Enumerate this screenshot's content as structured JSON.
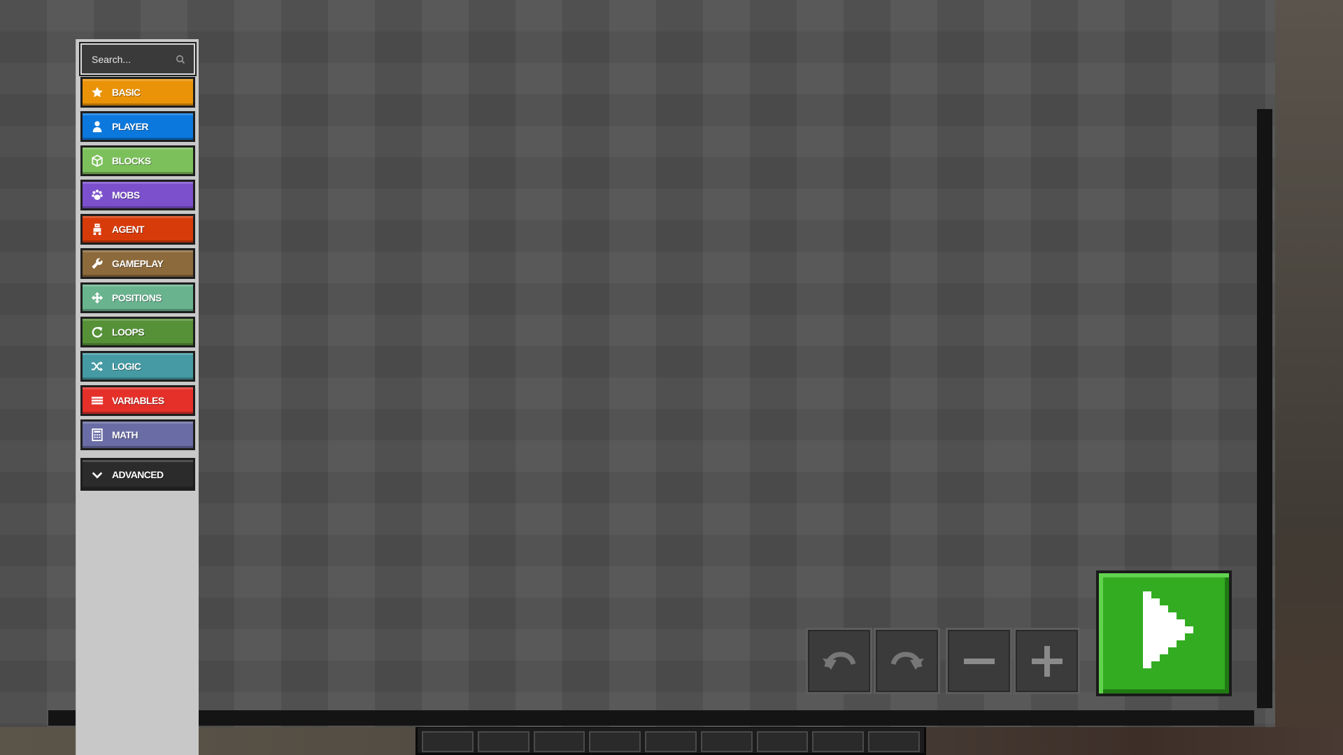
{
  "search": {
    "placeholder": "Search..."
  },
  "toolbox": {
    "categories": [
      {
        "label": "BASIC",
        "color": "#ea9308",
        "icon": "star-icon"
      },
      {
        "label": "PLAYER",
        "color": "#0b78dd",
        "icon": "person-icon"
      },
      {
        "label": "BLOCKS",
        "color": "#7cc05b",
        "icon": "cube-icon"
      },
      {
        "label": "MOBS",
        "color": "#7c50cc",
        "icon": "paw-icon"
      },
      {
        "label": "AGENT",
        "color": "#d83b0a",
        "icon": "agent-icon"
      },
      {
        "label": "GAMEPLAY",
        "color": "#8d6a3c",
        "icon": "wrench-icon"
      },
      {
        "label": "POSITIONS",
        "color": "#69b38f",
        "icon": "crosshair-icon"
      },
      {
        "label": "LOOPS",
        "color": "#569138",
        "icon": "refresh-icon"
      },
      {
        "label": "LOGIC",
        "color": "#459aa3",
        "icon": "shuffle-icon"
      },
      {
        "label": "VARIABLES",
        "color": "#e5302a",
        "icon": "list-icon"
      },
      {
        "label": "MATH",
        "color": "#6a6da5",
        "icon": "calculator-icon"
      }
    ],
    "advanced": {
      "label": "ADVANCED",
      "color": "#2b2b2b",
      "icon": "chevron-down-icon"
    }
  },
  "toolbar": {
    "undo": "undo-icon",
    "redo": "redo-icon",
    "zoom_out": "minus-icon",
    "zoom_in": "plus-icon",
    "run": "play-icon",
    "run_color": "#33ac22"
  }
}
